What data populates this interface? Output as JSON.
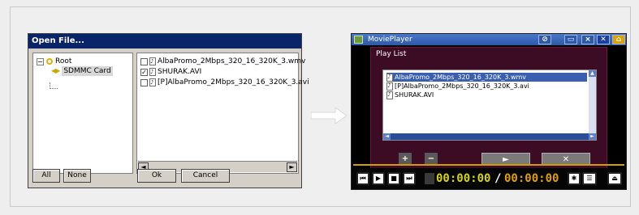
{
  "open_file": {
    "title": "Open File...",
    "tree": {
      "root_label": "Root",
      "child_label": "SDMMC Card",
      "card_icon_text": "◀▶"
    },
    "files": [
      {
        "name": "AlbaPromo_2Mbps_320_16_320K_3.wmv",
        "checked": false
      },
      {
        "name": "SHURAK.AVI",
        "checked": true
      },
      {
        "name": "[P]AlbaPromo_2Mbps_320_16_320K_3.avi",
        "checked": false
      }
    ],
    "buttons": {
      "all": "All",
      "none": "None",
      "ok": "Ok",
      "cancel": "Cancel"
    }
  },
  "movie_player": {
    "title": "MoviePlayer",
    "title_buttons": [
      "⊘",
      "▭",
      "×",
      "✕",
      "⌂"
    ],
    "playlist": {
      "title": "Play List",
      "items": [
        "AlbaPromo_2Mbps_320_16_320K_3.wmv",
        "[P]AlbaPromo_2Mbps_320_16_320K_3.avi",
        "SHURAK.AVI"
      ],
      "add_label": "+",
      "remove_label": "−",
      "play_label": "►",
      "close_label": "✕"
    },
    "controls": {
      "prev": "⏮",
      "play": "▶",
      "stop": "■",
      "next": "⏭"
    },
    "time_current": "00:00:00",
    "time_separator": "/",
    "time_total": "00:00:00",
    "colors": {
      "time_current": "#d6d600",
      "time_total": "#e0a000",
      "accent": "#3b0c24"
    }
  }
}
